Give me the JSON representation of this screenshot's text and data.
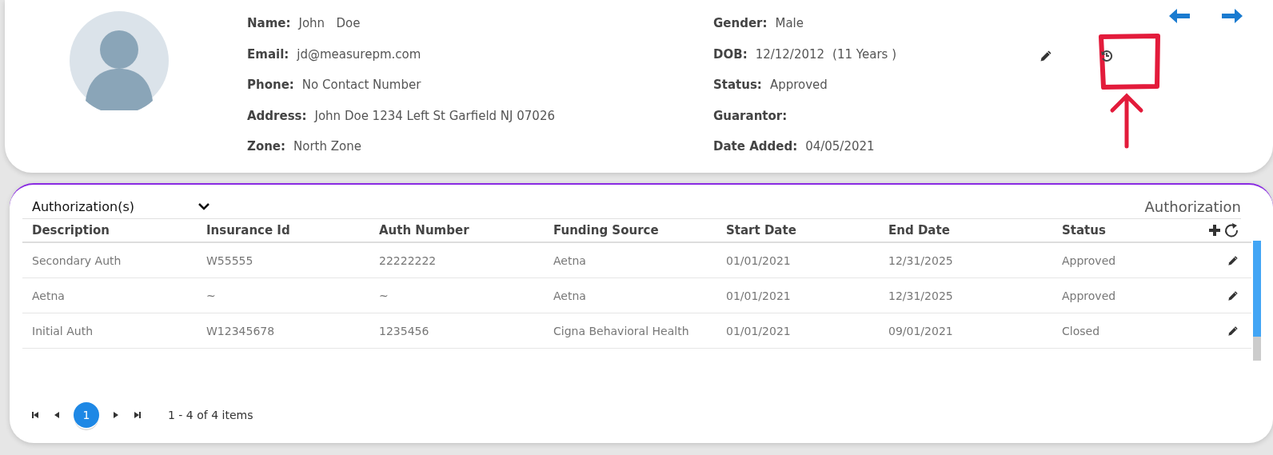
{
  "profile": {
    "left_fields": [
      {
        "label": "Name:",
        "value": "John   Doe"
      },
      {
        "label": "Email:",
        "value": "jd@measurepm.com"
      },
      {
        "label": "Phone:",
        "value": "No Contact Number"
      },
      {
        "label": "Address:",
        "value": "John Doe 1234 Left St Garfield NJ 07026"
      },
      {
        "label": "Zone:",
        "value": "North Zone"
      }
    ],
    "right_fields": [
      {
        "label": "Gender:",
        "value": "Male"
      },
      {
        "label": "DOB:",
        "value": "12/12/2012",
        "note": "(11 Years )"
      },
      {
        "label": "Status:",
        "value": "Approved"
      },
      {
        "label": "Guarantor:"
      },
      {
        "label": "Date Added:",
        "value": "04/05/2021"
      }
    ]
  },
  "authorizations": {
    "dropdown": "Authorization(s)",
    "title": "Authorization",
    "columns": [
      "Description",
      "Insurance Id",
      "Auth Number",
      "Funding Source",
      "Start Date",
      "End Date",
      "Status"
    ],
    "rows": [
      {
        "cells": [
          "Secondary Auth",
          "W55555",
          "22222222",
          "Aetna",
          "01/01/2021",
          "12/31/2025",
          "Approved"
        ]
      },
      {
        "cells": [
          "Aetna",
          "~",
          "~",
          "Aetna",
          "01/01/2021",
          "12/31/2025",
          "Approved"
        ]
      },
      {
        "cells": [
          "Initial Auth",
          "W12345678",
          "1235456",
          "Cigna Behavioral Health",
          "01/01/2021",
          "09/01/2021",
          "Closed"
        ]
      }
    ],
    "pager": {
      "pages": [
        {
          "label": "1",
          "selected": true
        }
      ],
      "summary": "1 - 4 of 4 items"
    }
  }
}
